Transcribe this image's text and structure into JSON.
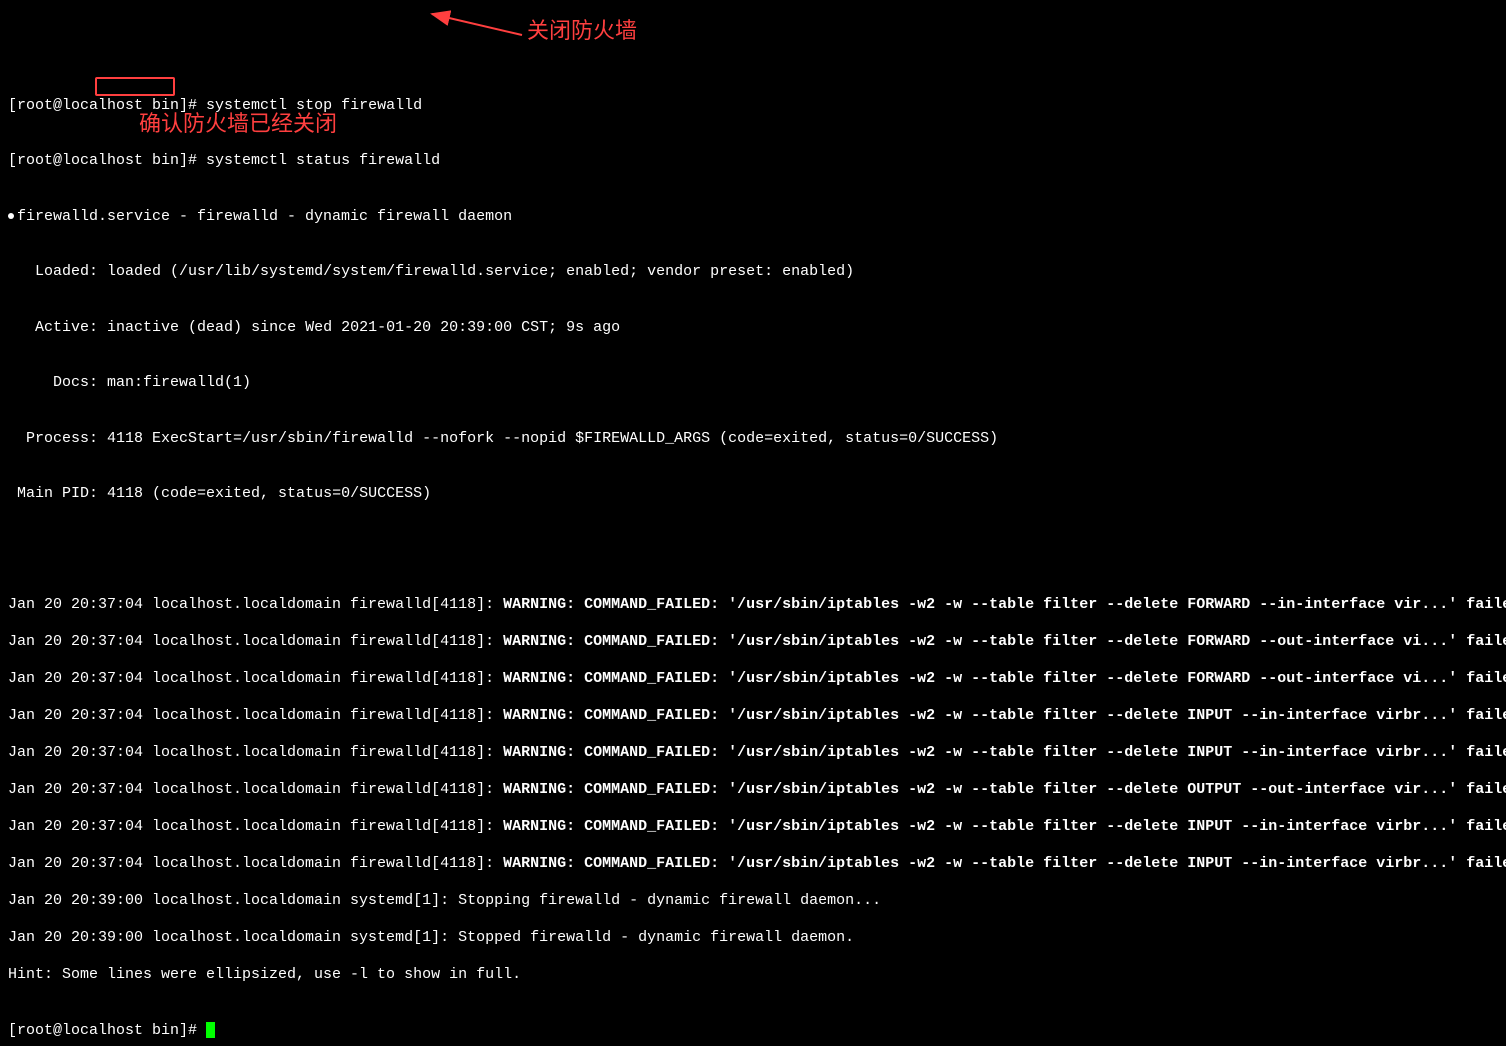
{
  "prompt1": "[root@localhost bin]# ",
  "cmd1": "systemctl stop firewalld",
  "prompt2": "[root@localhost bin]# ",
  "cmd2": "systemctl status firewalld",
  "service_header": "firewalld.service - firewalld - dynamic firewall daemon",
  "loaded_label": "   Loaded: ",
  "loaded_value": "loaded (/usr/lib/systemd/system/firewalld.service; enabled; vendor preset: enabled)",
  "active_label": "   Active: ",
  "active_state": "inactive",
  "active_dead": " (dead)",
  "active_since": " since Wed 2021-01-20 20:39:00 CST; 9s ago",
  "docs_label": "     Docs: ",
  "docs_value": "man:firewalld(1)",
  "process_label": "  Process: ",
  "process_value": "4118 ExecStart=/usr/sbin/firewalld --nofork --nopid $FIREWALLD_ARGS (code=exited, status=0/SUCCESS)",
  "mainpid_label": " Main PID: ",
  "mainpid_value": "4118 (code=exited, status=0/SUCCESS)",
  "log_prefix_fw": "Jan 20 20:37:04 localhost.localdomain firewalld[4118]: ",
  "warn1_bold": "WARNING: COMMAND_FAILED: '/usr/sbin/iptables -w2 -w --table filter --delete FORWARD --in-interface vir...' faile",
  "warn2_bold": "WARNING: COMMAND_FAILED: '/usr/sbin/iptables -w2 -w --table filter --delete FORWARD --out-interface vi...' faile",
  "warn3_bold": "WARNING: COMMAND_FAILED: '/usr/sbin/iptables -w2 -w --table filter --delete FORWARD --out-interface vi...' faile",
  "warn4_bold": "WARNING: COMMAND_FAILED: '/usr/sbin/iptables -w2 -w --table filter --delete INPUT --in-interface virbr...' faile",
  "warn5_bold": "WARNING: COMMAND_FAILED: '/usr/sbin/iptables -w2 -w --table filter --delete INPUT --in-interface virbr...' faile",
  "warn6_bold": "WARNING: COMMAND_FAILED: '/usr/sbin/iptables -w2 -w --table filter --delete OUTPUT --out-interface vir...' faile",
  "warn7_bold": "WARNING: COMMAND_FAILED: '/usr/sbin/iptables -w2 -w --table filter --delete INPUT --in-interface virbr...' faile",
  "warn8_bold": "WARNING: COMMAND_FAILED: '/usr/sbin/iptables -w2 -w --table filter --delete INPUT --in-interface virbr...' faile",
  "log_stop": "Jan 20 20:39:00 localhost.localdomain systemd[1]: Stopping firewalld - dynamic firewall daemon...",
  "log_stopped": "Jan 20 20:39:00 localhost.localdomain systemd[1]: Stopped firewalld - dynamic firewall daemon.",
  "hint": "Hint: Some lines were ellipsized, use -l to show in full.",
  "prompt3": "[root@localhost bin]# ",
  "annot_top": "关闭防火墙",
  "annot_mid": "确认防火墙已经关闭"
}
